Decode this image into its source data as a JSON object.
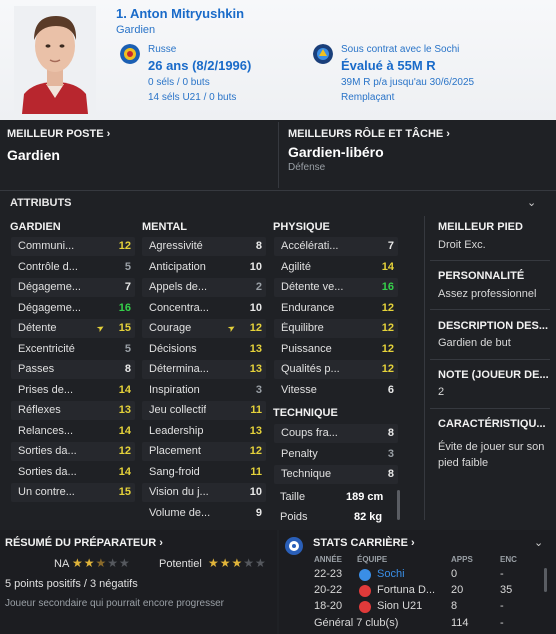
{
  "header": {
    "name": "1. Anton Mitryushkin",
    "position": "Gardien",
    "nationality": "Russe",
    "age": "26 ans (8/2/1996)",
    "caps": "0 séls / 0 buts",
    "u21": "14 séls U21 / 0 buts",
    "contract_label": "Sous contrat avec le Sochi",
    "value": "Évalué à 55M R",
    "wage": "39M R p/a jusqu'au 30/6/2025",
    "squad_status": "Remplaçant"
  },
  "best_position": {
    "title": "MEILLEUR POSTE",
    "value": "Gardien"
  },
  "best_role": {
    "title": "MEILLEURS RÔLE ET TÂCHE",
    "value": "Gardien-libéro",
    "duty": "Défense"
  },
  "attributes": {
    "title": "ATTRIBUTS",
    "gardien_title": "GARDIEN",
    "mental_title": "MENTAL",
    "physique_title": "PHYSIQUE",
    "technique_title": "TECHNIQUE",
    "gardien": [
      {
        "name": "Communi...",
        "value": "12",
        "color": "#e5d23a"
      },
      {
        "name": "Contrôle d...",
        "value": "5",
        "color": "#9aa0a6"
      },
      {
        "name": "Dégageme...",
        "value": "7",
        "color": "#e8e8e8"
      },
      {
        "name": "Dégageme...",
        "value": "16",
        "color": "#35d04a"
      },
      {
        "name": "Détente",
        "value": "15",
        "color": "#e5d23a"
      },
      {
        "name": "Excentricité",
        "value": "5",
        "color": "#9aa0a6"
      },
      {
        "name": "Passes",
        "value": "8",
        "color": "#e8e8e8"
      },
      {
        "name": "Prises de...",
        "value": "14",
        "color": "#e5d23a"
      },
      {
        "name": "Réflexes",
        "value": "13",
        "color": "#e5d23a"
      },
      {
        "name": "Relances...",
        "value": "14",
        "color": "#e5d23a"
      },
      {
        "name": "Sorties da...",
        "value": "12",
        "color": "#e5d23a"
      },
      {
        "name": "Sorties da...",
        "value": "14",
        "color": "#e5d23a"
      },
      {
        "name": "Un contre...",
        "value": "15",
        "color": "#e5d23a"
      }
    ],
    "mental": [
      {
        "name": "Agressivité",
        "value": "8",
        "color": "#e8e8e8"
      },
      {
        "name": "Anticipation",
        "value": "10",
        "color": "#e8e8e8"
      },
      {
        "name": "Appels de...",
        "value": "2",
        "color": "#9aa0a6"
      },
      {
        "name": "Concentra...",
        "value": "10",
        "color": "#e8e8e8"
      },
      {
        "name": "Courage",
        "value": "12",
        "color": "#e5d23a"
      },
      {
        "name": "Décisions",
        "value": "13",
        "color": "#e5d23a"
      },
      {
        "name": "Détermina...",
        "value": "13",
        "color": "#e5d23a"
      },
      {
        "name": "Inspiration",
        "value": "3",
        "color": "#9aa0a6"
      },
      {
        "name": "Jeu collectif",
        "value": "11",
        "color": "#e5d23a"
      },
      {
        "name": "Leadership",
        "value": "13",
        "color": "#e5d23a"
      },
      {
        "name": "Placement",
        "value": "12",
        "color": "#e5d23a"
      },
      {
        "name": "Sang-froid",
        "value": "11",
        "color": "#e5d23a"
      },
      {
        "name": "Vision du j...",
        "value": "10",
        "color": "#e8e8e8"
      },
      {
        "name": "Volume de...",
        "value": "9",
        "color": "#e8e8e8"
      }
    ],
    "physique": [
      {
        "name": "Accélérati...",
        "value": "7",
        "color": "#e8e8e8"
      },
      {
        "name": "Agilité",
        "value": "14",
        "color": "#e5d23a"
      },
      {
        "name": "Détente ve...",
        "value": "16",
        "color": "#35d04a"
      },
      {
        "name": "Endurance",
        "value": "12",
        "color": "#e5d23a"
      },
      {
        "name": "Équilibre",
        "value": "12",
        "color": "#e5d23a"
      },
      {
        "name": "Puissance",
        "value": "12",
        "color": "#e5d23a"
      },
      {
        "name": "Qualités p...",
        "value": "12",
        "color": "#e5d23a"
      },
      {
        "name": "Vitesse",
        "value": "6",
        "color": "#e8e8e8"
      }
    ],
    "technique": [
      {
        "name": "Coups fra...",
        "value": "8",
        "color": "#e8e8e8"
      },
      {
        "name": "Penalty",
        "value": "3",
        "color": "#9aa0a6"
      },
      {
        "name": "Technique",
        "value": "8",
        "color": "#e8e8e8"
      }
    ],
    "size": {
      "taille_label": "Taille",
      "taille": "189 cm",
      "poids_label": "Poids",
      "poids": "82 kg"
    }
  },
  "side": {
    "foot_title": "MEILLEUR PIED",
    "foot_value": "Droit Exc.",
    "personality_title": "PERSONNALITÉ",
    "personality_value": "Assez professionnel",
    "description_title": "DESCRIPTION DES...",
    "description_value": "Gardien de but",
    "note_title": "NOTE (JOUEUR DE...",
    "note_value": "2",
    "traits_title": "CARACTÉRISTIQU...",
    "traits_value": "Évite de jouer sur son pied faible"
  },
  "scout": {
    "title": "RÉSUMÉ DU PRÉPARATEUR",
    "na_label": "NA",
    "potential_label": "Potentiel",
    "summary": "5 points positifs / 3 négatifs",
    "comment": "Joueur secondaire qui pourrait encore progresser"
  },
  "career": {
    "title": "STATS CARRIÈRE",
    "col_year": "ANNÉE",
    "col_team": "ÉQUIPE",
    "col_apps": "APPS",
    "col_enc": "ENC",
    "rows": [
      {
        "year": "22-23",
        "team": "Sochi",
        "apps": "0",
        "enc": "-",
        "color": "#3a8ee6"
      },
      {
        "year": "20-22",
        "team": "Fortuna D...",
        "apps": "20",
        "enc": "35",
        "color": "#e03a3a"
      },
      {
        "year": "18-20",
        "team": "Sion U21",
        "apps": "8",
        "enc": "-",
        "color": "#e03a3a"
      }
    ],
    "total_label": "Général 7 club(s)",
    "total_apps": "114",
    "total_enc": "-"
  }
}
